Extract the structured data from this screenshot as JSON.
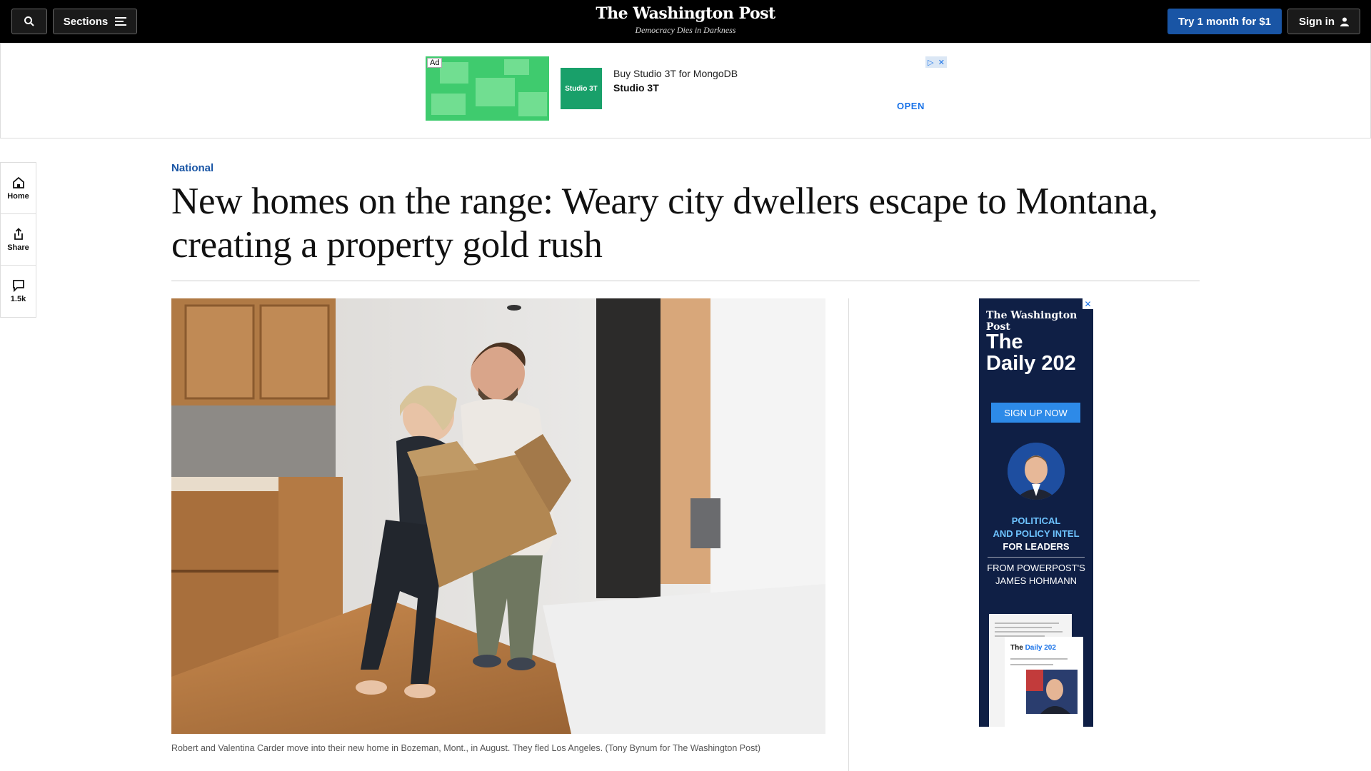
{
  "nav": {
    "sections_label": "Sections",
    "brand_name": "The Washington Post",
    "brand_tagline": "Democracy Dies in Darkness",
    "trial_label": "Try 1 month for $1",
    "signin_label": "Sign in"
  },
  "banner_ad": {
    "ad_label": "Ad",
    "title": "Buy Studio 3T for MongoDB",
    "brand": "Studio 3T",
    "logo_text": "Studio 3T",
    "cta": "OPEN"
  },
  "rail": {
    "home_label": "Home",
    "share_label": "Share",
    "comments_count": "1.5k"
  },
  "article": {
    "section": "National",
    "headline": "New homes on the range: Weary city dwellers escape to Montana, creating a property gold rush",
    "caption": "Robert and Valentina Carder move into their new home in Bozeman, Mont., in August. They fled Los Angeles. (Tony Bynum for The Washington Post)"
  },
  "side_ad": {
    "brand": "The Washington Post",
    "title_line1": "The",
    "title_line2": "Daily 202",
    "cta": "SIGN UP NOW",
    "line1": "POLITICAL",
    "line2": "AND POLICY INTEL",
    "line3": "FOR LEADERS",
    "line4": "FROM POWERPOST'S",
    "line5": "JAMES HOHMANN",
    "paper_title_a": "The ",
    "paper_title_b": "Daily 202"
  },
  "colors": {
    "accent_blue": "#1955a5",
    "nav_background": "#000000",
    "side_ad_background": "#0f1f45"
  }
}
